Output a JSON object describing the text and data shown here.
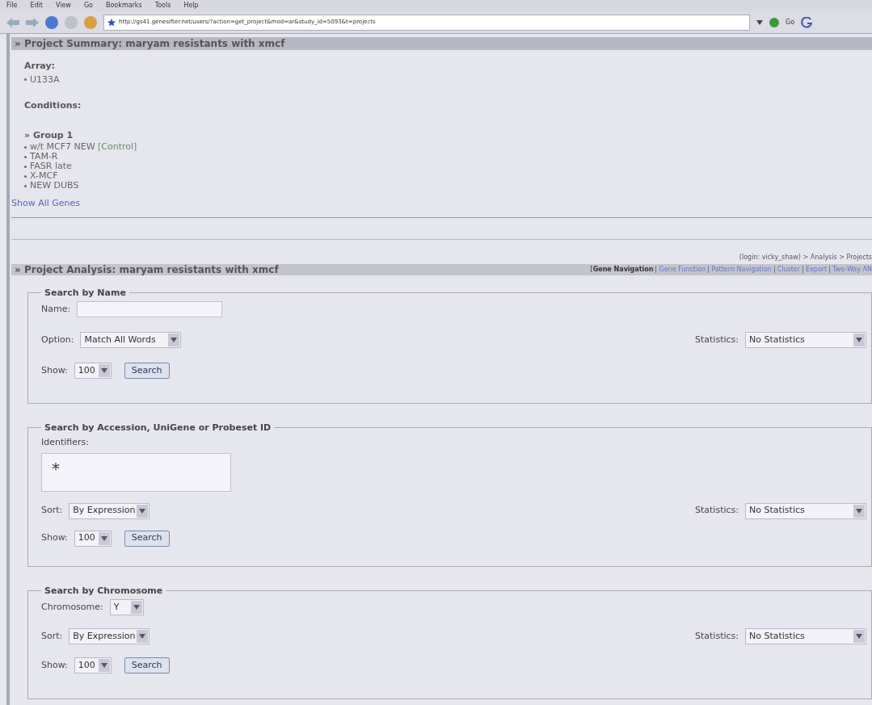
{
  "browser": {
    "menu": [
      "File",
      "Edit",
      "View",
      "Go",
      "Bookmarks",
      "Tools",
      "Help"
    ],
    "url": "http://gs41.genesifter.net/users/?action=get_project&mod=ar&study_id=5093&t=projects",
    "go": "Go"
  },
  "summary": {
    "title": "» Project Summary: maryam resistants with xmcf",
    "array_label": "Array:",
    "arrays": [
      "U133A"
    ],
    "conditions_label": "Conditions:",
    "group": "» Group 1",
    "conditions": [
      {
        "name": "w/t MCF7 NEW",
        "tag": "[Control]"
      },
      {
        "name": "TAM-R"
      },
      {
        "name": "FASR late"
      },
      {
        "name": "X-MCF"
      },
      {
        "name": "NEW DUBS"
      }
    ],
    "link": "Show All Genes"
  },
  "breadcrumb": "(login: vicky_shaw) > Analysis > Projects",
  "analysis": {
    "title": "» Project Analysis: maryam resistants with xmcf",
    "bracket": "[",
    "tabs": [
      {
        "label": "Gene Navigation",
        "selected": true
      },
      {
        "label": "Gene Function",
        "selected": false
      },
      {
        "label": "Pattern Navigation",
        "selected": false
      },
      {
        "label": "Cluster",
        "selected": false
      },
      {
        "label": "Export",
        "selected": false
      },
      {
        "label": "Two-Way AN",
        "selected": false
      }
    ]
  },
  "sections": [
    {
      "title": "Search by Name",
      "rows": [
        {
          "kind": "input",
          "label": "Name:"
        },
        {
          "kind": "select",
          "label": "Option:",
          "value": "Match All Words",
          "stats_label": "Statistics:",
          "stats_value": "No Statistics"
        },
        {
          "kind": "show",
          "label": "Show:",
          "value": "100",
          "button": "Search"
        }
      ]
    },
    {
      "title": "Search by Accession, UniGene or Probeset ID",
      "rows": [
        {
          "kind": "textarea",
          "label": "Identifiers:",
          "value": "*"
        },
        {
          "kind": "select",
          "label": "Sort:",
          "value": "By Expression",
          "stats_label": "Statistics:",
          "stats_value": "No Statistics"
        },
        {
          "kind": "show",
          "label": "Show:",
          "value": "100",
          "button": "Search"
        }
      ]
    },
    {
      "title": "Search by Chromosome",
      "rows": [
        {
          "kind": "select",
          "label": "Chromosome:",
          "value": "Y"
        },
        {
          "kind": "select",
          "label": "Sort:",
          "value": "By Expression",
          "stats_label": "Statistics:",
          "stats_value": "No Statistics"
        },
        {
          "kind": "show",
          "label": "Show:",
          "value": "100",
          "button": "Search"
        }
      ]
    }
  ]
}
